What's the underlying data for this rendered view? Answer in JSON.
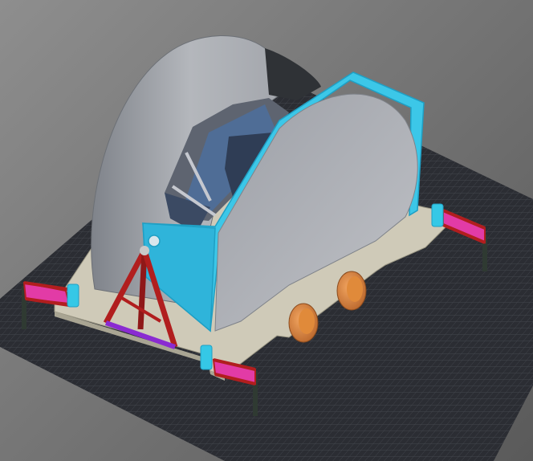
{
  "viewport": {
    "background_top": "#8e8e8e",
    "background_bottom": "#5a5a5a"
  },
  "scene": {
    "colors": {
      "floor_grid": "#2b2d33",
      "floor_grid_line": "#43464d",
      "base_plate": "#cfcab8",
      "base_plate_edge": "#9c9885",
      "dome_shell": "#a9acb2",
      "dome_shell_dark": "#7f838a",
      "dome_back": "#2f3236",
      "frame_cyan": "#3cc7e8",
      "frame_cyan_dark": "#1f9fc4",
      "interior_blue": "#4f6d96",
      "wheel_orange": "#e08a3a",
      "strut_red": "#b11e1e",
      "strut_pink": "#e23ba6",
      "leg_purple": "#8a2bd1",
      "post_dark": "#2f3a32",
      "jack_cyan": "#35c8e6"
    },
    "icons": [
      "floor-grid",
      "base-plate",
      "dome-shell",
      "cyan-frame",
      "tripod-stand",
      "wheel",
      "outrigger-jack"
    ]
  }
}
